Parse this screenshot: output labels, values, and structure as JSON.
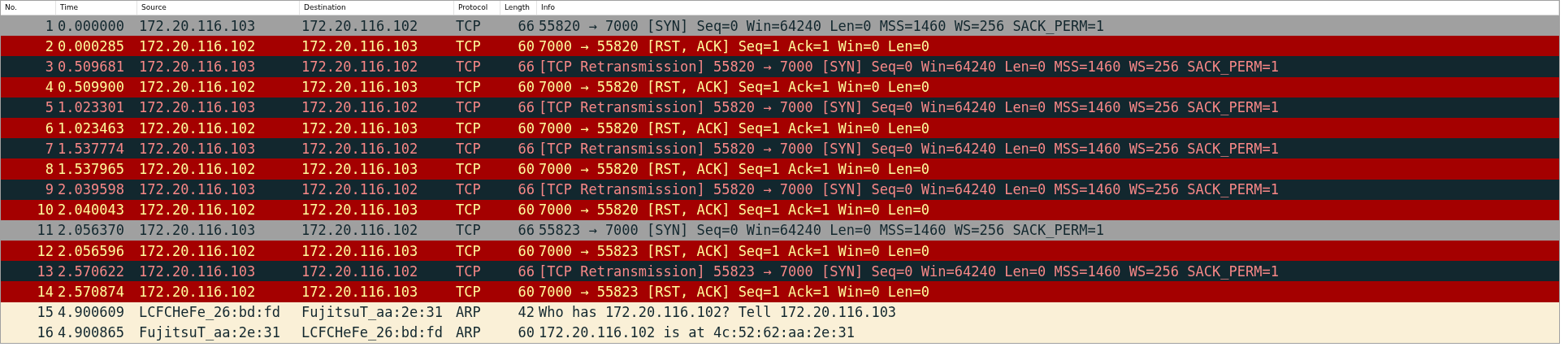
{
  "columns": [
    "No.",
    "Time",
    "Source",
    "Destination",
    "Protocol",
    "Length",
    "Info"
  ],
  "packets": [
    {
      "kind": "syn",
      "no": "1",
      "time": "0.000000",
      "source": "172.20.116.103",
      "destination": "172.20.116.102",
      "protocol": "TCP",
      "length": "66",
      "info": "55820 → 7000 [SYN] Seq=0 Win=64240 Len=0 MSS=1460 WS=256 SACK_PERM=1"
    },
    {
      "kind": "rst",
      "no": "2",
      "time": "0.000285",
      "source": "172.20.116.102",
      "destination": "172.20.116.103",
      "protocol": "TCP",
      "length": "60",
      "info": "7000 → 55820 [RST, ACK] Seq=1 Ack=1 Win=0 Len=0"
    },
    {
      "kind": "retransmission",
      "no": "3",
      "time": "0.509681",
      "source": "172.20.116.103",
      "destination": "172.20.116.102",
      "protocol": "TCP",
      "length": "66",
      "info": "[TCP Retransmission] 55820 → 7000 [SYN] Seq=0 Win=64240 Len=0 MSS=1460 WS=256 SACK_PERM=1"
    },
    {
      "kind": "rst",
      "no": "4",
      "time": "0.509900",
      "source": "172.20.116.102",
      "destination": "172.20.116.103",
      "protocol": "TCP",
      "length": "60",
      "info": "7000 → 55820 [RST, ACK] Seq=1 Ack=1 Win=0 Len=0"
    },
    {
      "kind": "retransmission",
      "no": "5",
      "time": "1.023301",
      "source": "172.20.116.103",
      "destination": "172.20.116.102",
      "protocol": "TCP",
      "length": "66",
      "info": "[TCP Retransmission] 55820 → 7000 [SYN] Seq=0 Win=64240 Len=0 MSS=1460 WS=256 SACK_PERM=1"
    },
    {
      "kind": "rst",
      "no": "6",
      "time": "1.023463",
      "source": "172.20.116.102",
      "destination": "172.20.116.103",
      "protocol": "TCP",
      "length": "60",
      "info": "7000 → 55820 [RST, ACK] Seq=1 Ack=1 Win=0 Len=0"
    },
    {
      "kind": "retransmission",
      "no": "7",
      "time": "1.537774",
      "source": "172.20.116.103",
      "destination": "172.20.116.102",
      "protocol": "TCP",
      "length": "66",
      "info": "[TCP Retransmission] 55820 → 7000 [SYN] Seq=0 Win=64240 Len=0 MSS=1460 WS=256 SACK_PERM=1"
    },
    {
      "kind": "rst",
      "no": "8",
      "time": "1.537965",
      "source": "172.20.116.102",
      "destination": "172.20.116.103",
      "protocol": "TCP",
      "length": "60",
      "info": "7000 → 55820 [RST, ACK] Seq=1 Ack=1 Win=0 Len=0"
    },
    {
      "kind": "retransmission",
      "no": "9",
      "time": "2.039598",
      "source": "172.20.116.103",
      "destination": "172.20.116.102",
      "protocol": "TCP",
      "length": "66",
      "info": "[TCP Retransmission] 55820 → 7000 [SYN] Seq=0 Win=64240 Len=0 MSS=1460 WS=256 SACK_PERM=1"
    },
    {
      "kind": "rst",
      "no": "10",
      "time": "2.040043",
      "source": "172.20.116.102",
      "destination": "172.20.116.103",
      "protocol": "TCP",
      "length": "60",
      "info": "7000 → 55820 [RST, ACK] Seq=1 Ack=1 Win=0 Len=0"
    },
    {
      "kind": "syn",
      "no": "11",
      "time": "2.056370",
      "source": "172.20.116.103",
      "destination": "172.20.116.102",
      "protocol": "TCP",
      "length": "66",
      "info": "55823 → 7000 [SYN] Seq=0 Win=64240 Len=0 MSS=1460 WS=256 SACK_PERM=1"
    },
    {
      "kind": "rst",
      "no": "12",
      "time": "2.056596",
      "source": "172.20.116.102",
      "destination": "172.20.116.103",
      "protocol": "TCP",
      "length": "60",
      "info": "7000 → 55823 [RST, ACK] Seq=1 Ack=1 Win=0 Len=0"
    },
    {
      "kind": "retransmission",
      "no": "13",
      "time": "2.570622",
      "source": "172.20.116.103",
      "destination": "172.20.116.102",
      "protocol": "TCP",
      "length": "66",
      "info": "[TCP Retransmission] 55823 → 7000 [SYN] Seq=0 Win=64240 Len=0 MSS=1460 WS=256 SACK_PERM=1"
    },
    {
      "kind": "rst",
      "no": "14",
      "time": "2.570874",
      "source": "172.20.116.102",
      "destination": "172.20.116.103",
      "protocol": "TCP",
      "length": "60",
      "info": "7000 → 55823 [RST, ACK] Seq=1 Ack=1 Win=0 Len=0"
    },
    {
      "kind": "arp",
      "no": "15",
      "time": "4.900609",
      "source": "LCFCHeFe_26:bd:fd",
      "destination": "FujitsuT_aa:2e:31",
      "protocol": "ARP",
      "length": "42",
      "info": "Who has 172.20.116.102? Tell 172.20.116.103"
    },
    {
      "kind": "arp",
      "no": "16",
      "time": "4.900865",
      "source": "FujitsuT_aa:2e:31",
      "destination": "LCFCHeFe_26:bd:fd",
      "protocol": "ARP",
      "length": "60",
      "info": "172.20.116.102 is at 4c:52:62:aa:2e:31"
    }
  ]
}
